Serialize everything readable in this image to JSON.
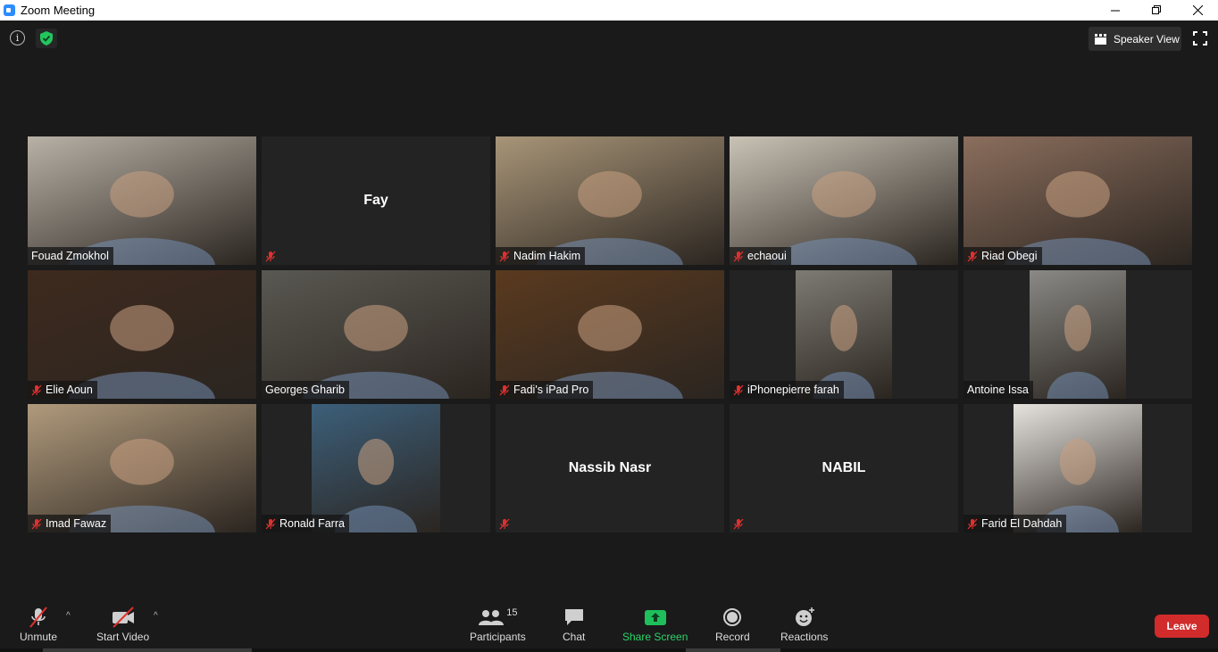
{
  "window": {
    "title": "Zoom Meeting"
  },
  "top": {
    "view_label": "Speaker View"
  },
  "participants": [
    {
      "name": "Fouad Zmokhol",
      "muted": false,
      "video": true,
      "active": true,
      "bg": "#b8b1a6"
    },
    {
      "name": "Fay",
      "muted": true,
      "video": false
    },
    {
      "name": "Nadim Hakim",
      "muted": true,
      "video": true,
      "bg": "#a89578"
    },
    {
      "name": "echaoui",
      "muted": true,
      "video": true,
      "bg": "#c9c3b6"
    },
    {
      "name": "Riad Obegi",
      "muted": true,
      "video": true,
      "bg": "#8b6e5d"
    },
    {
      "name": "Elie Aoun",
      "muted": true,
      "video": true,
      "bg": "#3e2a1e"
    },
    {
      "name": "Georges Gharib",
      "muted": false,
      "video": true,
      "bg": "#5a5852"
    },
    {
      "name": "Fadi's iPad Pro",
      "muted": true,
      "video": true,
      "bg": "#5a3a1f"
    },
    {
      "name": "iPhonepierre farah",
      "muted": true,
      "video": true,
      "bg": "#7d7b73"
    },
    {
      "name": "Antoine Issa",
      "muted": false,
      "video": true,
      "bg": "#8a8985"
    },
    {
      "name": "Imad Fawaz",
      "muted": true,
      "video": true,
      "bg": "#b09a7c"
    },
    {
      "name": "Ronald Farra",
      "muted": true,
      "video": true,
      "bg": "#3c5f7a"
    },
    {
      "name": "Nassib Nasr",
      "muted": true,
      "video": false
    },
    {
      "name": "NABIL",
      "muted": true,
      "video": false
    },
    {
      "name": "Farid El Dahdah",
      "muted": true,
      "video": true,
      "bg": "#e6e3de"
    }
  ],
  "toolbar": {
    "unmute": "Unmute",
    "start_video": "Start Video",
    "participants": "Participants",
    "participants_count": "15",
    "chat": "Chat",
    "share_screen": "Share Screen",
    "record": "Record",
    "reactions": "Reactions",
    "leave": "Leave"
  }
}
